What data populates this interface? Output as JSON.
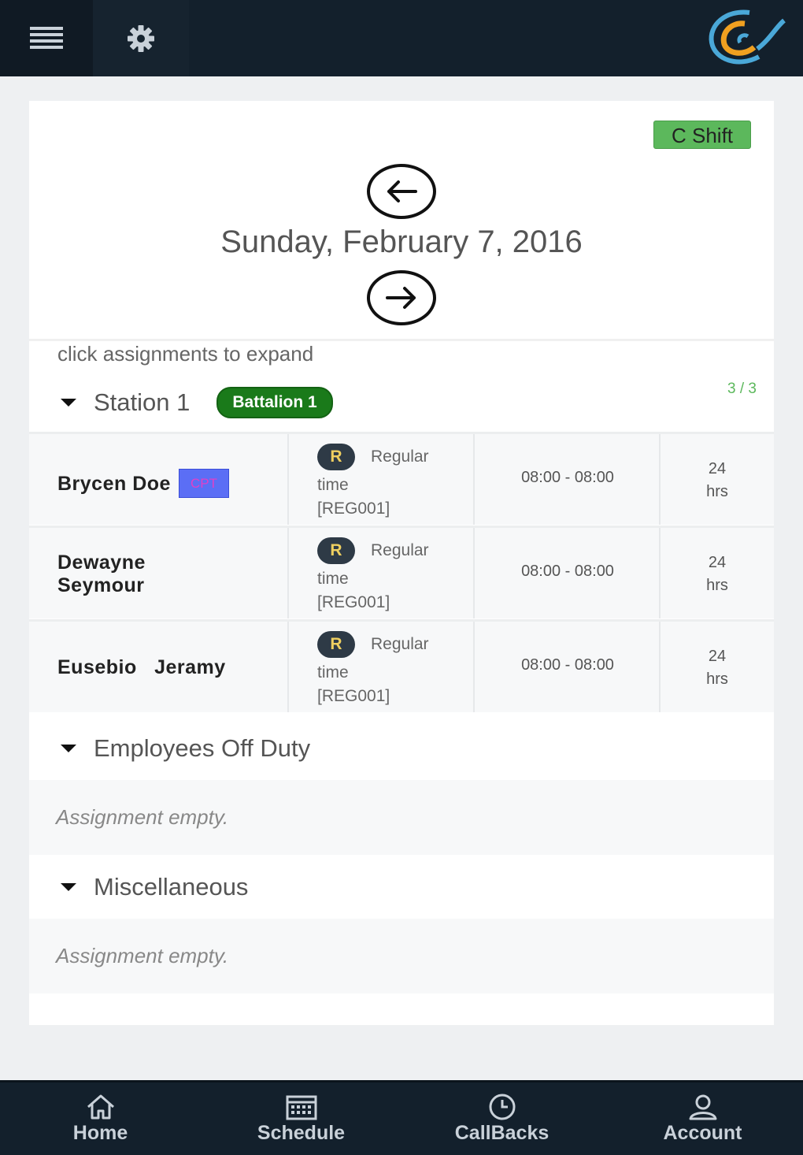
{
  "topbar": {
    "menu_icon": "hamburger-icon",
    "settings_icon": "gear-icon"
  },
  "shift": {
    "label": "C Shift",
    "color": "#5cb85c"
  },
  "date": {
    "title": "Sunday, February 7, 2016"
  },
  "hint": "click assignments to expand",
  "station": {
    "title": "Station 1",
    "battalion": "Battalion 1",
    "count": "3 / 3"
  },
  "assignments": [
    {
      "name_line1": "Brycen Doe",
      "name_line2": "",
      "rank": "CPT",
      "badge": "R",
      "type_line1": "Regular",
      "type_line2": "time",
      "type_line3": "[REG001]",
      "time": "08:00 - 08:00",
      "hours_value": "24",
      "hours_unit": "hrs"
    },
    {
      "name_line1": "Dewayne",
      "name_line2": "Seymour",
      "rank": "",
      "badge": "R",
      "type_line1": "Regular",
      "type_line2": "time",
      "type_line3": "[REG001]",
      "time": "08:00 - 08:00",
      "hours_value": "24",
      "hours_unit": "hrs"
    },
    {
      "name_line1": "Eusebio   Jeramy",
      "name_line2": "",
      "rank": "",
      "badge": "R",
      "type_line1": "Regular",
      "type_line2": "time",
      "type_line3": "[REG001]",
      "time": "08:00 - 08:00",
      "hours_value": "24",
      "hours_unit": "hrs"
    }
  ],
  "off_duty": {
    "title": "Employees Off Duty",
    "empty": "Assignment empty."
  },
  "misc": {
    "title": "Miscellaneous",
    "empty": "Assignment empty."
  },
  "bottom_nav": [
    {
      "label": "Home",
      "icon": "home-icon"
    },
    {
      "label": "Schedule",
      "icon": "calendar-icon"
    },
    {
      "label": "CallBacks",
      "icon": "clock-icon"
    },
    {
      "label": "Account",
      "icon": "user-icon"
    }
  ],
  "colors": {
    "header_bg": "#13202c",
    "battalion_green": "#1a7a1a",
    "cpt_badge": "#5b6ef5"
  }
}
